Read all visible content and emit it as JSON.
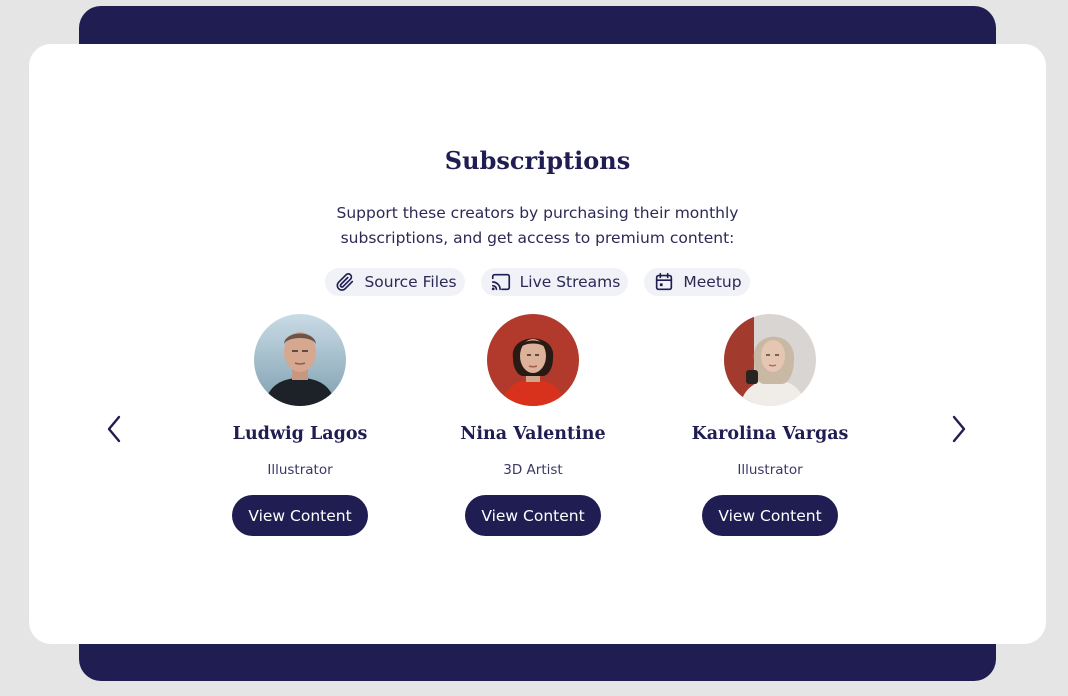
{
  "section": {
    "title": "Subscriptions",
    "subtitle_line1": "Support these creators by purchasing their monthly",
    "subtitle_line2": "subscriptions, and get access to premium content:"
  },
  "features": [
    {
      "label": "Source Files",
      "icon": "paperclip-icon"
    },
    {
      "label": "Live Streams",
      "icon": "cast-icon"
    },
    {
      "label": "Meetup",
      "icon": "calendar-icon"
    }
  ],
  "creators": [
    {
      "name": "Ludwig Lagos",
      "role": "Illustrator",
      "button": "View Content"
    },
    {
      "name": "Nina Valentine",
      "role": "3D Artist",
      "button": "View Content"
    },
    {
      "name": "Karolina Vargas",
      "role": "Illustrator",
      "button": "View Content"
    }
  ],
  "nav": {
    "prev_icon": "chevron-left-icon",
    "next_icon": "chevron-right-icon"
  },
  "colors": {
    "brand": "#201d52",
    "page_bg": "#e5e5e5",
    "card_bg": "#ffffff",
    "pill_bg": "#f1f1f8"
  }
}
